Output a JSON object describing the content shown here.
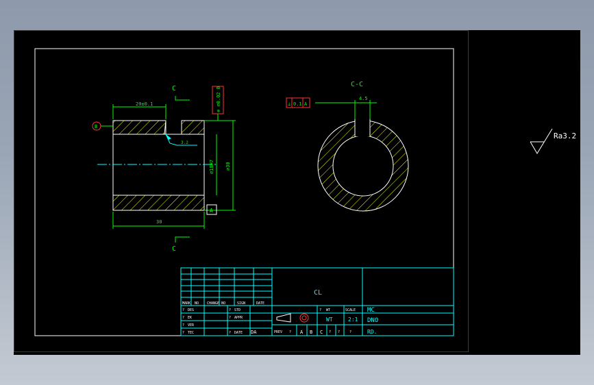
{
  "section_label_top": "C",
  "section_label_bottom": "C",
  "section_view_title": "C-C",
  "datum_b_label": "B",
  "datum_a_label": "A",
  "dim_length_top": "20±0.1",
  "dim_length_bottom": "30",
  "dim_bore": "⌀18H7",
  "dim_outer": "⌀30",
  "dim_slot": "4.5",
  "tolerance_frame_left": "⊚ ⌀0.02 B",
  "tolerance_frame_right": [
    "⊥",
    "0.1",
    "A"
  ],
  "surface_finish_local": "3.2",
  "surface_finish_global": "Ra3.2",
  "title_block": {
    "name": "CL",
    "row_labels_a": [
      "?",
      "?",
      "?",
      "?",
      "?",
      "?",
      "?"
    ],
    "mark_headers": [
      "MARK",
      "NO",
      "CHANGE NO",
      "SIGN",
      "DATE"
    ],
    "des": "DES",
    "ek": "EK",
    "ver": "VER",
    "tec": "TEC",
    "std": "STD",
    "appr": "APPR",
    "date": "DATE",
    "date_val": "DA",
    "wt_header": "WT",
    "scale_header": "SCALE",
    "wt_value": "WT",
    "scale_value": "2:1",
    "prev": "PREV",
    "cell_a": "A",
    "cell_b": "B",
    "cell_c": "C",
    "q": "?",
    "mc": "MC",
    "dno": "DNO",
    "rd": "RD."
  },
  "colors": {
    "outline": "#ffffff",
    "dimension": "#00ff00",
    "hatch": "#ffff00",
    "centerline": "#00ffff",
    "table": "#00ffff",
    "frame_red": "#ff3333",
    "text_white": "#e0e0e0"
  }
}
